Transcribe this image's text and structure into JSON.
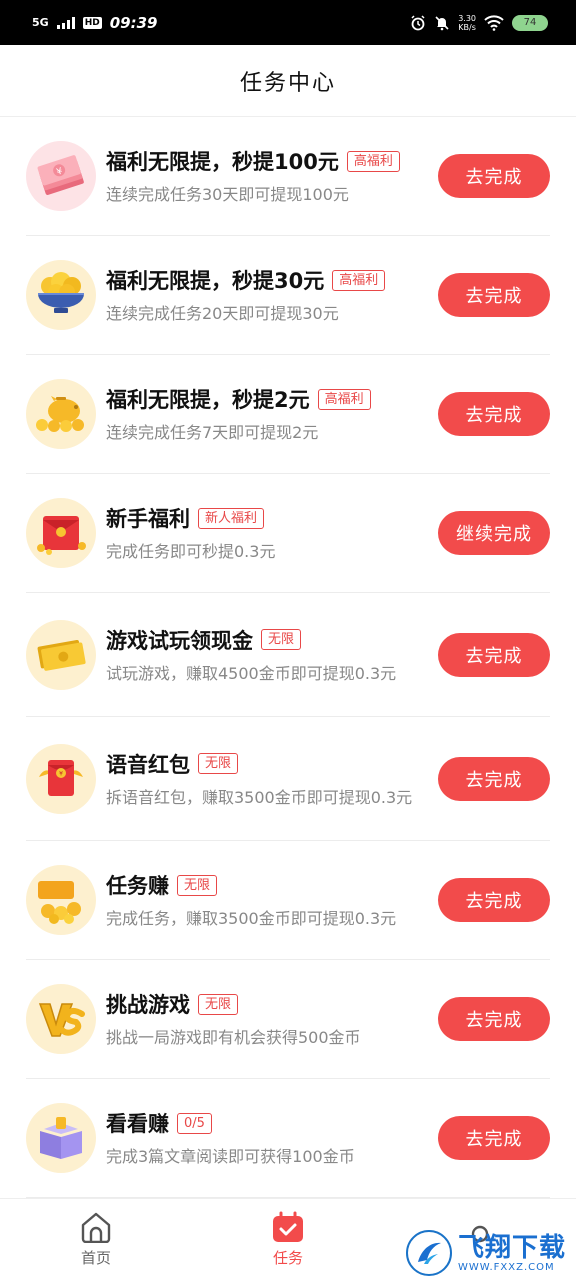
{
  "status_bar": {
    "network": "5G",
    "hd": "HD",
    "time": "09:39",
    "speed_value": "3.30",
    "speed_unit": "KB/s",
    "battery": "74"
  },
  "header": {
    "title": "任务中心"
  },
  "tasks": [
    {
      "title": "福利无限提，秒提100元",
      "tag": "高福利",
      "desc": "连续完成任务30天即可提现100元",
      "button": "去完成",
      "icon": "cash-stack-icon"
    },
    {
      "title": "福利无限提，秒提30元",
      "tag": "高福利",
      "desc": "连续完成任务20天即可提现30元",
      "button": "去完成",
      "icon": "gold-bowl-icon"
    },
    {
      "title": "福利无限提，秒提2元",
      "tag": "高福利",
      "desc": "连续完成任务7天即可提现2元",
      "button": "去完成",
      "icon": "piggy-bank-icon"
    },
    {
      "title": "新手福利",
      "tag": "新人福利",
      "desc": "完成任务即可秒提0.3元",
      "button": "继续完成",
      "icon": "red-envelope-gift-icon"
    },
    {
      "title": "游戏试玩领现金",
      "tag": "无限",
      "desc": "试玩游戏，赚取4500金币即可提现0.3元",
      "button": "去完成",
      "icon": "cash-icon"
    },
    {
      "title": "语音红包",
      "tag": "无限",
      "desc": "拆语音红包，赚取3500金币即可提现0.3元",
      "button": "去完成",
      "icon": "red-packet-icon"
    },
    {
      "title": "任务赚",
      "tag": "无限",
      "desc": "完成任务，赚取3500金币即可提现0.3元",
      "button": "去完成",
      "icon": "follow-coins-icon"
    },
    {
      "title": "挑战游戏",
      "tag": "无限",
      "desc": "挑战一局游戏即有机会获得500金币",
      "button": "去完成",
      "icon": "vs-icon"
    },
    {
      "title": "看看赚",
      "tag": "0/5",
      "desc": "完成3篇文章阅读即可获得100金币",
      "button": "去完成",
      "icon": "book-icon"
    }
  ],
  "bottom_nav": {
    "items": [
      {
        "label": "首页",
        "active": false,
        "icon": "home-icon"
      },
      {
        "label": "任务",
        "active": true,
        "icon": "calendar-check-icon"
      }
    ]
  },
  "watermark": {
    "title": "飞翔下载",
    "url": "WWW.FXXZ.COM"
  },
  "colors": {
    "accent": "#f24b4b",
    "tag": "#e84848",
    "desc": "#888888"
  }
}
